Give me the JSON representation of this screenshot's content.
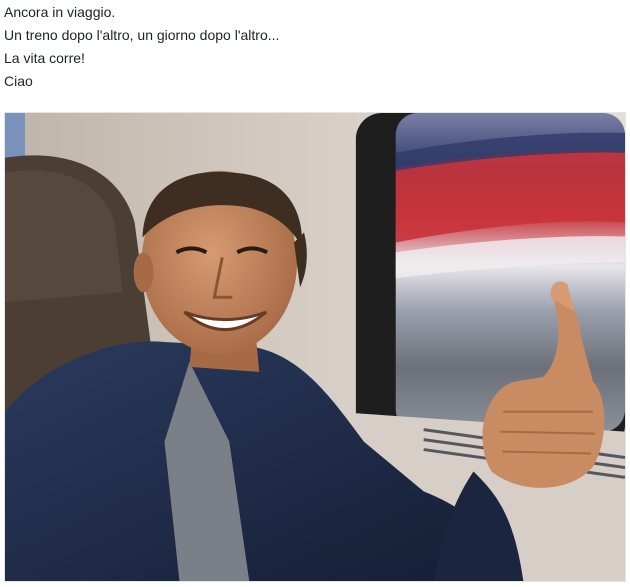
{
  "post": {
    "lines": [
      "Ancora in viaggio.",
      "Un treno dopo l'altro, un giorno dopo l'altro...",
      "La vita corre!",
      "Ciao"
    ]
  },
  "photo": {
    "subject": "man-taking-selfie-on-train",
    "colors": {
      "wall": "#cfc6bd",
      "seat": "#4a3e35",
      "jacket": "#1f2c4a",
      "skin": "#c98b62",
      "hair": "#3e2d21",
      "window_frame": "#2a2a2a",
      "blur_red": "#c9353c",
      "blur_blue": "#3b4a7a"
    }
  }
}
